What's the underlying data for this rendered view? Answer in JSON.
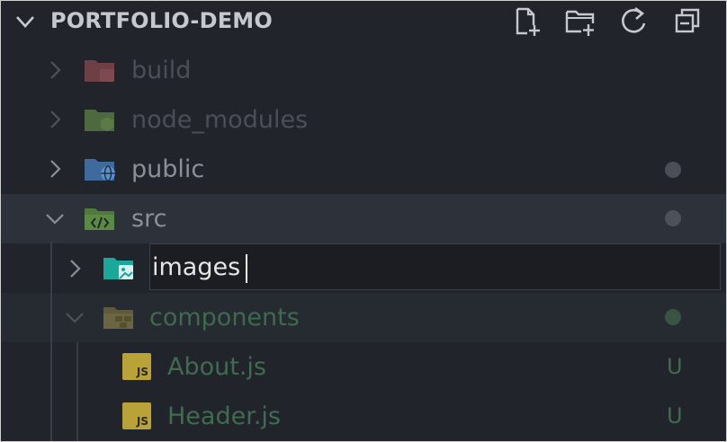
{
  "explorer": {
    "title": "PORTFOLIO-DEMO",
    "actions": [
      {
        "name": "new-file-icon"
      },
      {
        "name": "new-folder-icon"
      },
      {
        "name": "refresh-icon"
      },
      {
        "name": "collapse-all-icon"
      }
    ]
  },
  "tree": {
    "build": {
      "label": "build",
      "icon": "folder-build-icon"
    },
    "node_modules": {
      "label": "node_modules",
      "icon": "folder-node-icon"
    },
    "public": {
      "label": "public",
      "icon": "folder-public-icon"
    },
    "src": {
      "label": "src",
      "icon": "folder-src-icon"
    },
    "images": {
      "value": "images",
      "icon": "folder-images-icon"
    },
    "components": {
      "label": "components",
      "icon": "folder-components-icon"
    },
    "about": {
      "label": "About.js",
      "status": "U",
      "icon_text": "JS"
    },
    "header": {
      "label": "Header.js",
      "status": "U",
      "icon_text": "JS"
    }
  },
  "colors": {
    "background": "#21252b",
    "selected_row": "#2c313a",
    "untracked_green": "#73c991",
    "ignored": "#4b5058"
  }
}
